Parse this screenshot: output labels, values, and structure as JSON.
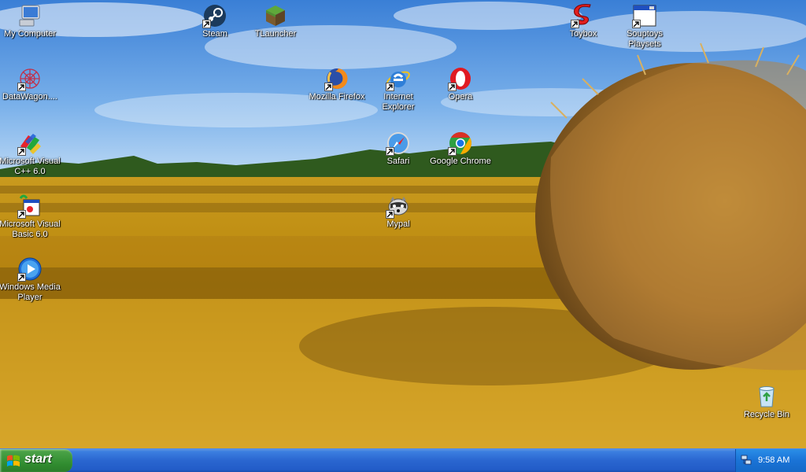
{
  "desktop": {
    "icons": {
      "my_computer": "My Computer",
      "steam": "Steam",
      "tlauncher": "TLauncher",
      "toybox": "Toybox",
      "souptoys": "Souptoys Playsets",
      "datawagon": "DataWagon....",
      "firefox": "Mozilla Firefox",
      "ie": "Internet Explorer",
      "opera": "Opera",
      "msvc": "Microsoft Visual C++ 6.0",
      "safari": "Safari",
      "chrome": "Google Chrome",
      "vb": "Microsoft Visual Basic 6.0",
      "mypal": "Mypal",
      "wmp": "Windows Media Player",
      "recycle": "Recycle Bin"
    }
  },
  "taskbar": {
    "start_label": "start",
    "clock": "9:58 AM"
  },
  "colors": {
    "taskbar_blue": "#245edb",
    "start_green": "#3c963a",
    "tray_blue": "#1a73d6"
  }
}
